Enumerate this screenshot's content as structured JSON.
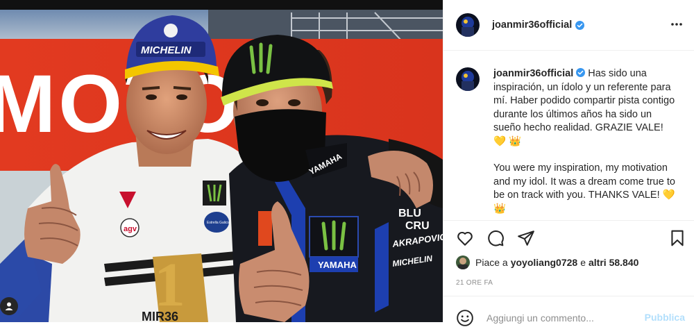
{
  "post": {
    "handle": "joanmir36official",
    "caption_p1": "Has sido una inspiración, un ídolo y un referente para mí. Haber podido compartir pista contigo durante los últimos años ha sido un sueño hecho realidad. GRAZIE VALE! 💛 👑",
    "caption_p2": "You were my inspiration, my motivation and my idol. It was a dream come true to be on track with you. THANKS VALE! 💛 👑",
    "likes_prefix": "Piace a",
    "likes_user": "yoyoliang0728",
    "likes_conj": "e",
    "likes_others": "altri 58.840",
    "time_ago": "21 ORE FA"
  },
  "comment_box": {
    "placeholder": "Aggiungi un commento...",
    "publish_label": "Pubblica"
  },
  "photo": {
    "banner_text": "MOTO",
    "cap_left_text": "MICHELIN",
    "shirt_right_1": "BLU",
    "shirt_right_2": "CRU",
    "shirt_akra": "AKRAPOVIC",
    "shirt_yamaha": "YAMAHA",
    "shirt_michelin": "MICHELIN",
    "collar_yamaha": "YAMAHA",
    "estrella": "Estrella Galicia",
    "agv": "agv",
    "number_text": "1",
    "mir_text": "MIR36"
  },
  "colors": {
    "verified_blue": "#3897f0",
    "publish_disabled": "#b2dffc",
    "banner_red": "#e33b22",
    "monster_green": "#7ac143"
  },
  "icons": {
    "more": "more-horizontal-icon",
    "like": "heart-icon",
    "comment": "comment-bubble-icon",
    "share": "paper-plane-icon",
    "save": "bookmark-icon",
    "emoji": "smiley-icon",
    "verified": "verified-badge-icon",
    "tag": "user-tag-icon"
  }
}
